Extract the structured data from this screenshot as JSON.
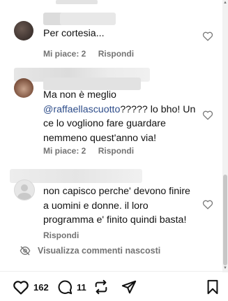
{
  "comments": [
    {
      "text": "Per cortesia...",
      "likes_label": "Mi piace: 2",
      "reply_label": "Rispondi"
    },
    {
      "text_before": "Ma non è meglio ",
      "mention": "@raffaellascuotto",
      "text_after": "????? lo bho! Un ce lo vogliono fare guardare nemmeno quest'anno via!",
      "likes_label": "Mi piace: 2",
      "reply_label": "Rispondi"
    },
    {
      "text": "non capisco perche' devono finire a uomini e donne. il loro programma e' finito quindi basta!",
      "reply_label": "Rispondi"
    }
  ],
  "hidden_comments_label": "Visualizza commenti nascosti",
  "actions": {
    "like_count": "162",
    "comment_count": "11"
  },
  "icons": [
    "heart-icon",
    "comment-icon",
    "repost-icon",
    "share-icon",
    "bookmark-icon",
    "eye-off-icon"
  ]
}
